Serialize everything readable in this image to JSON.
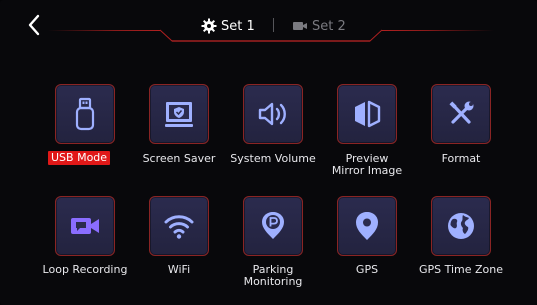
{
  "header": {
    "tabs": [
      {
        "label": "Set 1",
        "icon": "gear-icon",
        "active": true
      },
      {
        "label": "Set 2",
        "icon": "video-camera-icon",
        "active": false
      }
    ]
  },
  "colors": {
    "tile_bg": "#2b2b4e",
    "tile_border": "#8a2424",
    "icon_color": "#9fb0ff",
    "selected_label_bg": "#e01818",
    "background": "#08080b"
  },
  "items": [
    {
      "label": "USB Mode",
      "icon": "usb-drive-icon",
      "selected": true
    },
    {
      "label": "Screen Saver",
      "icon": "screen-saver-icon",
      "selected": false
    },
    {
      "label": "System Volume",
      "icon": "speaker-volume-icon",
      "selected": false
    },
    {
      "label": "Preview\nMirror Image",
      "icon": "mirror-image-icon",
      "selected": false
    },
    {
      "label": "Format",
      "icon": "wrench-screwdriver-icon",
      "selected": false
    },
    {
      "label": "Loop Recording",
      "icon": "loop-recording-camera-icon",
      "selected": false
    },
    {
      "label": "WiFi",
      "icon": "wifi-icon",
      "selected": false
    },
    {
      "label": "Parking\nMonitoring",
      "icon": "parking-pin-icon",
      "selected": false
    },
    {
      "label": "GPS",
      "icon": "location-pin-icon",
      "selected": false
    },
    {
      "label": "GPS Time Zone",
      "icon": "globe-icon",
      "selected": false
    }
  ]
}
